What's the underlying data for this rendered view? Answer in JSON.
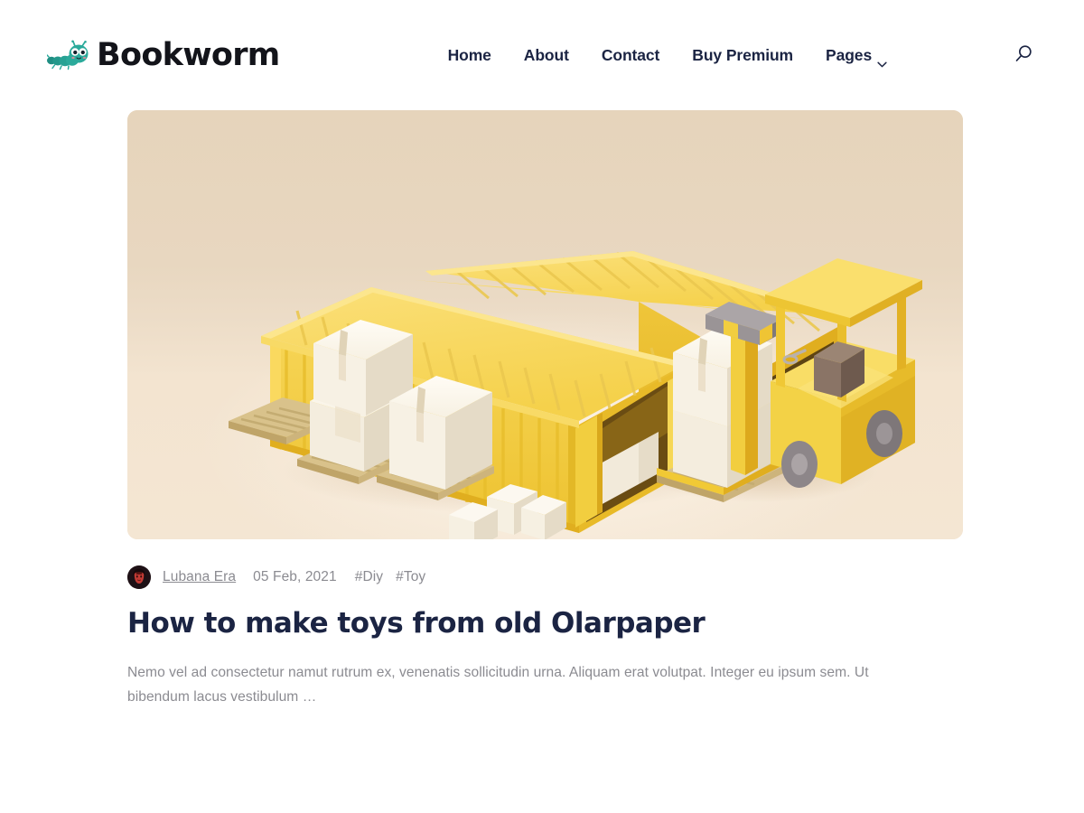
{
  "site": {
    "brand_name": "Bookworm",
    "logo_icon": "caterpillar-icon",
    "brand_teal": "#2BAA9B",
    "text_navy": "#1B2443",
    "muted_gray": "#8B8B91"
  },
  "header": {
    "nav": [
      {
        "label": "Home",
        "icon": ""
      },
      {
        "label": "About",
        "icon": ""
      },
      {
        "label": "Contact",
        "icon": ""
      },
      {
        "label": "Buy Premium",
        "icon": ""
      },
      {
        "label": "Pages",
        "icon": "chevron-down-icon"
      }
    ],
    "search_icon": "search-icon",
    "search_label": "Search"
  },
  "post": {
    "image_alt": "Isometric 3D illustration of two yellow shipping containers with white boxes on wooden pallets and a yellow forklift",
    "image_bg": "#E8D7BF",
    "container_yellow": "#F4D03F",
    "box_white": "#F6F1E6",
    "pallet_tan": "#D8C28A",
    "author": {
      "name": "Lubana Era",
      "avatar_icon": "avatar"
    },
    "date": "05 Feb, 2021",
    "tags": [
      "#Diy",
      "#Toy"
    ],
    "title": "How to make toys from old Olarpaper",
    "excerpt": "Nemo vel ad consectetur namut rutrum ex, venenatis sollicitudin urna. Aliquam erat volutpat. Integer eu ipsum sem. Ut bibendum lacus vestibulum …"
  }
}
